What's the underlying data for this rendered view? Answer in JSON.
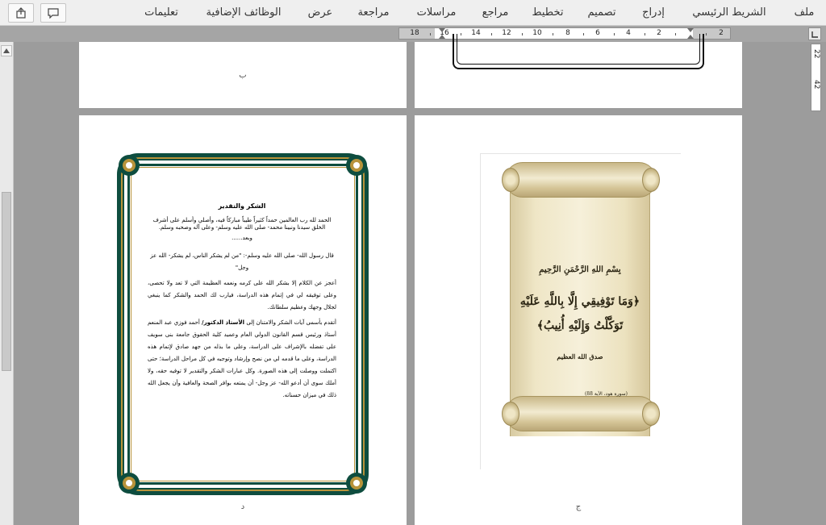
{
  "ribbon": {
    "tabs": [
      {
        "id": "file",
        "label": "ملف"
      },
      {
        "id": "home",
        "label": "الشريط الرئيسي"
      },
      {
        "id": "insert",
        "label": "إدراج"
      },
      {
        "id": "design",
        "label": "تصميم"
      },
      {
        "id": "layout",
        "label": "تخطيط"
      },
      {
        "id": "references",
        "label": "مراجع"
      },
      {
        "id": "mailings",
        "label": "مراسلات"
      },
      {
        "id": "review",
        "label": "مراجعة"
      },
      {
        "id": "view",
        "label": "عرض"
      },
      {
        "id": "addins",
        "label": "الوظائف الإضافية"
      },
      {
        "id": "help",
        "label": "تعليمات"
      }
    ],
    "buttons": {
      "comments_icon": "comment-icon",
      "share_icon": "share-icon"
    }
  },
  "ruler": {
    "labels": [
      "18",
      "16",
      "14",
      "12",
      "10",
      "8",
      "6",
      "4",
      "2",
      "2"
    ],
    "vertical_labels": [
      "22",
      "42"
    ]
  },
  "pages": {
    "top_left_letter": "ب",
    "bottom_left_letter": "د",
    "bottom_right_letter": "ج"
  },
  "acknowledgment": {
    "title": "الشكر والتقدير",
    "para1": "الحمد لله رب العالمين حمداً كثيراً طيباً مباركاً فيه، وأصلي وأسلم على أشرف الخلق سيدنا ونبينا محمد- صلى الله عليه وسلم- وعلى آله وصحبه وسلم.",
    "para1_end": "وبعد......",
    "para2": "قال رسول الله- صلى الله عليه وسلم-: \"من لم يشكر الناس، لم يشكر- الله عز وجل\"",
    "para3": "أعجز عن الكلام إلا بشكر الله على كرمه ونعمه العظيمة التي لا تعد ولا تحصى، وعلى توفيقه لي في إتمام هذه الدراسة، فيارب لك الحمد والشكر كما ينبغي لجلال وجهك وعظيم سلطانك.",
    "para4_start": "أتقدم بأسمى آيات الشكر والامتنان إلى",
    "para4_bold": "الأستاذ الدكتور/",
    "para4_rest": "أحمد فوزي عبد المنعم أستاذ ورئيس قسم القانون الدولي العام وعميد كلية الحقوق جامعة بنى سويف على تفضله بالإشراف على الدراسة، وعلى ما بذله من جهد صادق لإتمام هذه الدراسة، وعلى ما قدمه لي من نصح وإرشاد وتوجيه في كل مراحل الدراسة؛ حتى اكتملت ووصلت إلى هذه الصورة. وكل عبارات الشكر والتقدير لا توفيه حقه، ولا أملك سوى أن أدعو الله- عز وجل- أن يمتعه بوافر الصحة والعافية وأن يجعل الله ذلك في ميزان حسناته."
  },
  "scroll": {
    "basmala": "بِسْمِ اللهِ الرَّحْمَنِ الرَّحِيمِ",
    "verse_line1": "﴿وَمَا تَوْفِيقِي إِلَّا بِاللَّهِ عَلَيْهِ",
    "verse_line2": "تَوَكَّلْتُ وَإِلَيْهِ أُنِيبُ﴾",
    "sadaqa": "صدق الله العظيم",
    "citation": "(سورة هود، الآية 88)"
  },
  "colors": {
    "frame_green": "#0e4d3f",
    "frame_gold": "#b8933a",
    "canvas_gray": "#9c9c9c"
  }
}
